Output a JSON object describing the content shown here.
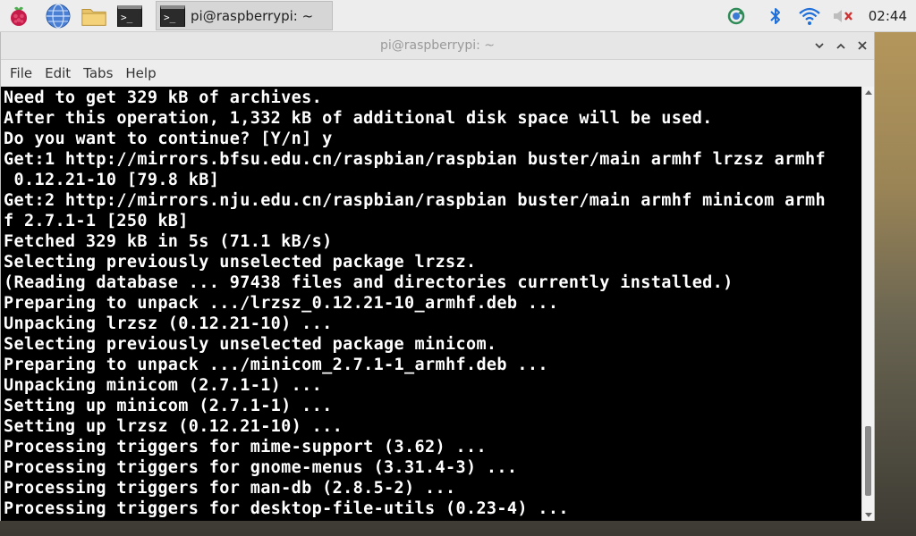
{
  "panel": {
    "launchers": [
      {
        "icon": "raspberry-menu-icon"
      },
      {
        "icon": "globe-browser-icon"
      },
      {
        "icon": "folder-icon"
      },
      {
        "icon": "terminal-icon"
      }
    ],
    "task_button": {
      "label": "pi@raspberrypi: ~",
      "icon": "terminal-icon"
    },
    "tray": [
      {
        "icon": "updater-icon"
      },
      {
        "icon": "bluetooth-icon"
      },
      {
        "icon": "wifi-icon"
      },
      {
        "icon": "volume-muted-icon"
      }
    ],
    "clock": "02:44"
  },
  "window": {
    "title": "pi@raspberrypi: ~",
    "menu": [
      {
        "label": "File"
      },
      {
        "label": "Edit"
      },
      {
        "label": "Tabs"
      },
      {
        "label": "Help"
      }
    ],
    "controls": {
      "minimize": "minimize-icon",
      "maximize": "maximize-icon",
      "close": "close-icon"
    }
  },
  "terminal": {
    "lines": [
      "Need to get 329 kB of archives.",
      "After this operation, 1,332 kB of additional disk space will be used.",
      "Do you want to continue? [Y/n] y",
      "Get:1 http://mirrors.bfsu.edu.cn/raspbian/raspbian buster/main armhf lrzsz armhf",
      " 0.12.21-10 [79.8 kB]",
      "Get:2 http://mirrors.nju.edu.cn/raspbian/raspbian buster/main armhf minicom armh",
      "f 2.7.1-1 [250 kB]",
      "Fetched 329 kB in 5s (71.1 kB/s)",
      "Selecting previously unselected package lrzsz.",
      "(Reading database ... 97438 files and directories currently installed.)",
      "Preparing to unpack .../lrzsz_0.12.21-10_armhf.deb ...",
      "Unpacking lrzsz (0.12.21-10) ...",
      "Selecting previously unselected package minicom.",
      "Preparing to unpack .../minicom_2.7.1-1_armhf.deb ...",
      "Unpacking minicom (2.7.1-1) ...",
      "Setting up minicom (2.7.1-1) ...",
      "Setting up lrzsz (0.12.21-10) ...",
      "Processing triggers for mime-support (3.62) ...",
      "Processing triggers for gnome-menus (3.31.4-3) ...",
      "Processing triggers for man-db (2.8.5-2) ...",
      "Processing triggers for desktop-file-utils (0.23-4) ..."
    ]
  },
  "colors": {
    "panel_bg": "#ededed",
    "terminal_bg": "#000000",
    "terminal_fg": "#ffffff"
  }
}
